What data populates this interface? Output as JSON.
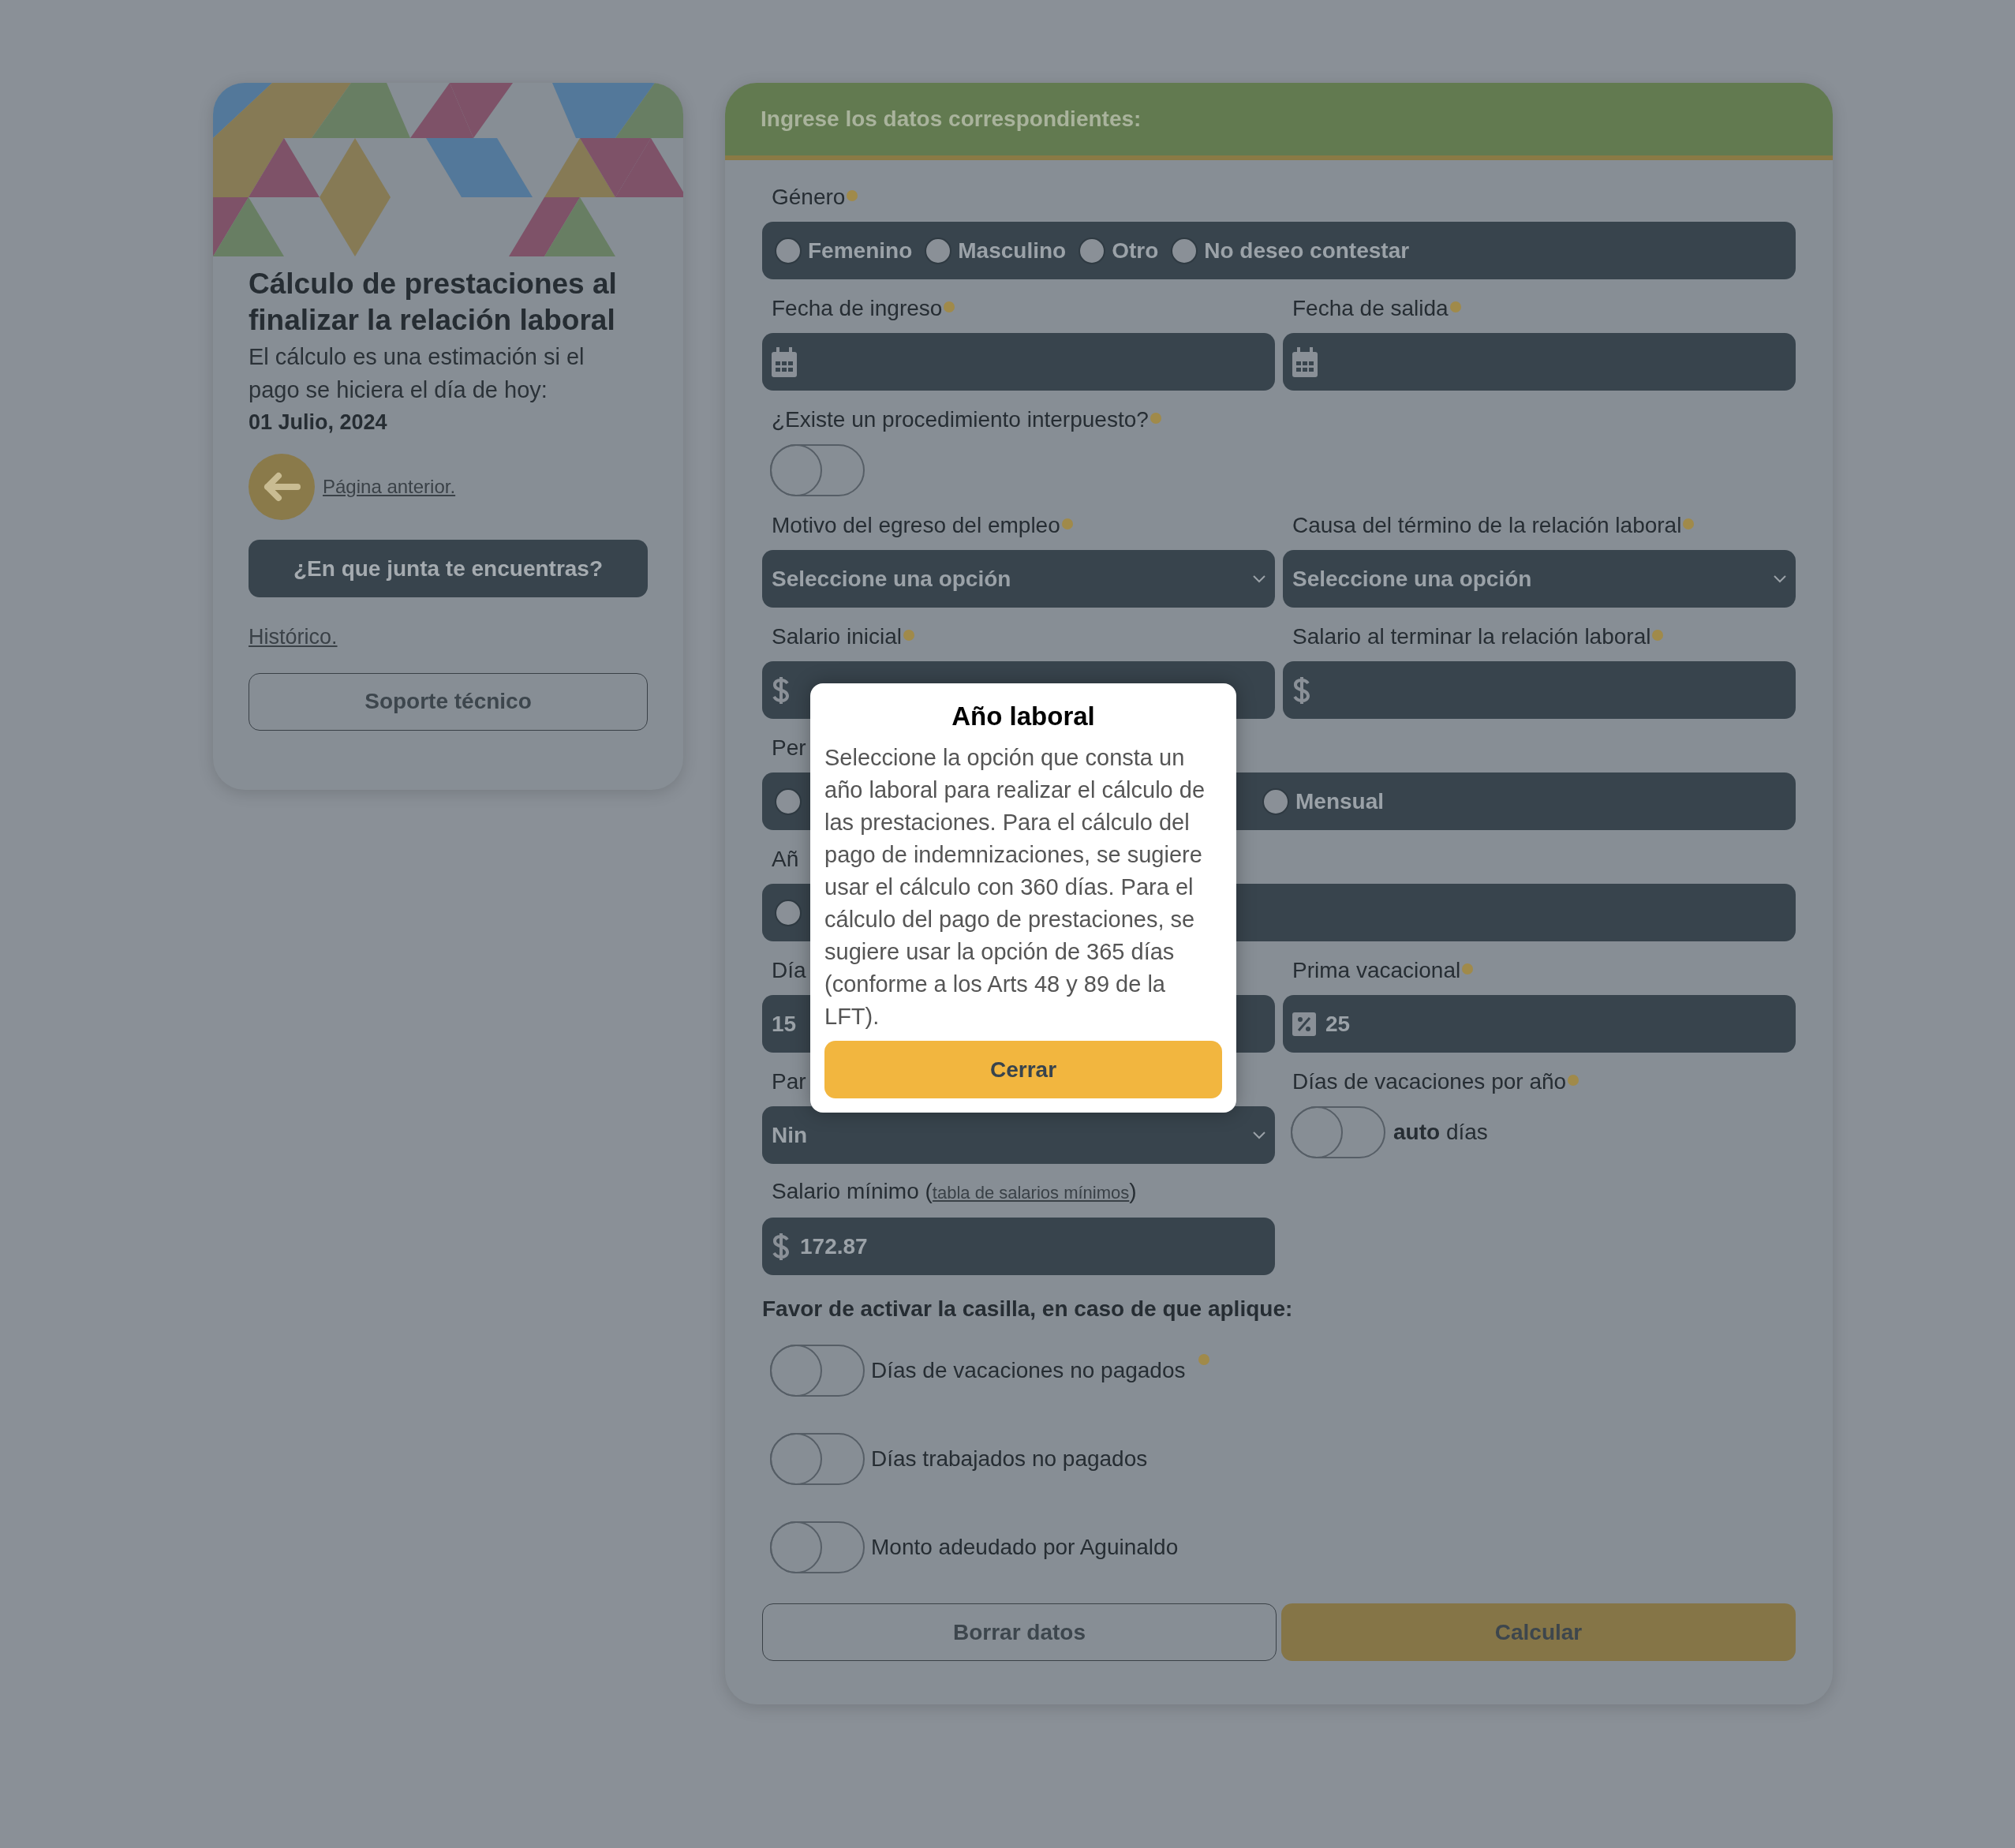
{
  "sidebar": {
    "title": "Cálculo de prestaciones al finalizar la relación laboral",
    "description": "El cálculo es una estimación si el pago se hiciera el día de hoy:",
    "date": "01 Julio, 2024",
    "back_link": "Página anterior.",
    "junta_button": "¿En que junta te encuentras?",
    "history_link": "Histórico.",
    "support_button": "Soporte técnico"
  },
  "form": {
    "header": "Ingrese los datos correspondientes:",
    "rows": [
      {
        "fields": [
          {
            "kind": "radio_group",
            "label": "Género",
            "info": true,
            "options": [
              {
                "label": "Femenino",
                "selected": false
              },
              {
                "label": "Masculino",
                "selected": false
              },
              {
                "label": "Otro",
                "selected": false
              },
              {
                "label": "No deseo contestar",
                "selected": false
              }
            ]
          }
        ]
      },
      {
        "fields": [
          {
            "kind": "date",
            "label": "Fecha de ingreso",
            "info": true
          },
          {
            "kind": "date",
            "label": "Fecha de salida",
            "info": true
          }
        ]
      },
      {
        "fields": [
          {
            "kind": "toggle",
            "label": "¿Existe un procedimiento interpuesto?",
            "info": true,
            "on": false
          }
        ]
      },
      {
        "fields": [
          {
            "kind": "select",
            "label": "Motivo del egreso del empleo",
            "info": true,
            "value": "Seleccione una opción"
          },
          {
            "kind": "select",
            "label": "Causa del término de la relación laboral",
            "info": true,
            "value": "Seleccione una opción"
          }
        ]
      },
      {
        "fields": [
          {
            "kind": "money",
            "label": "Salario inicial",
            "info": true
          },
          {
            "kind": "money",
            "label": "Salario al terminar la relación laboral",
            "info": true
          }
        ]
      },
      {
        "fields": [
          {
            "kind": "radio_group",
            "label": "Per",
            "info": false,
            "options": [
              {
                "selected": false
              },
              {
                "label": "Mensual",
                "selected": false
              }
            ]
          }
        ]
      },
      {
        "fields": [
          {
            "kind": "radio_group",
            "label": "Añ",
            "info": false,
            "options": [
              {
                "selected": false
              }
            ]
          }
        ]
      },
      {
        "fields": [
          {
            "kind": "number",
            "label": "Día",
            "info": false,
            "value": "15"
          },
          {
            "kind": "percent",
            "label": "Prima vacacional",
            "info": true,
            "value": "25"
          }
        ]
      },
      {
        "fields": [
          {
            "kind": "select",
            "label": "Par",
            "info": false,
            "value": "Nin"
          },
          {
            "kind": "toggle",
            "label": "Días de vacaciones por año",
            "info": true,
            "on": false,
            "text": "**auto** días"
          }
        ]
      },
      {
        "fields": [
          {
            "kind": "money",
            "label": "Salario mínimo (",
            "link": "tabla de salarios mínimos",
            "label_end": ")",
            "info": false,
            "value": "172.87"
          }
        ]
      }
    ],
    "note": "Favor de activar la casilla, en caso de que aplique:",
    "checks": [
      {
        "label": "Días de vacaciones no pagados",
        "on": false,
        "info": true
      },
      {
        "label": "Días trabajados no pagados",
        "on": false,
        "info": false
      },
      {
        "label": "Monto adeudado por Aguinaldo",
        "on": false,
        "info": false
      }
    ],
    "buttons": [
      "Borrar datos",
      "Calcular"
    ]
  },
  "modal": {
    "title": "Año laboral",
    "body": "Seleccione la opción que consta un año laboral para realizar el cálculo de las prestaciones. Para el cálculo del pago de indemnizaciones, se sugiere usar el cálculo con 360 días. Para el cálculo del pago de prestaciones, se sugiere usar la opción de 365 días (conforme a los Arts 48 y 89 de la LFT).",
    "button": "Cerrar"
  }
}
